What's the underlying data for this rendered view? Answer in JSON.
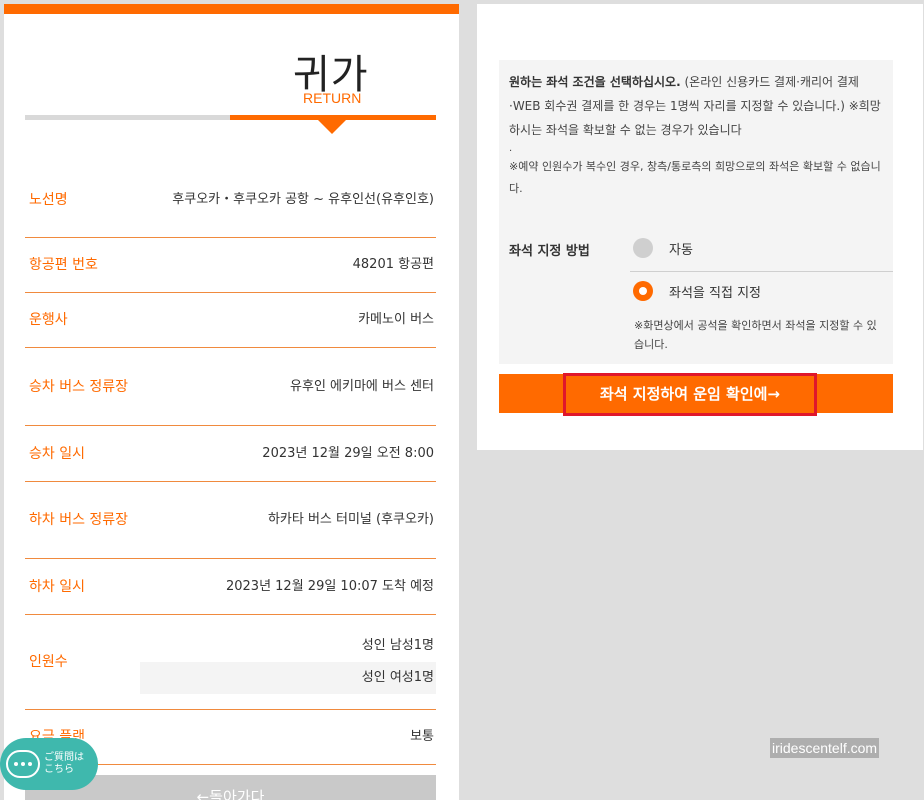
{
  "header": {
    "title_ko": "귀가",
    "title_en": "RETURN"
  },
  "info": {
    "route_label": "노선명",
    "route_value": "후쿠오카・후쿠오카 공항 ~ 유후인선(유후인호)",
    "flight_label": "항공편 번호",
    "flight_value": "48201 항공편",
    "operator_label": "운행사",
    "operator_value": "카메노이 버스",
    "board_stop_label": "승차 버스 정류장",
    "board_stop_value": "유후인 에키마에 버스 센터",
    "board_time_label": "승차 일시",
    "board_time_value": "2023년 12월 29일 오전 8:00",
    "alight_stop_label": "하차 버스 정류장",
    "alight_stop_value": "하카타 버스 터미널 (후쿠오카)",
    "alight_time_label": "하차 일시",
    "alight_time_value": "2023년 12월 29일 10:07 도착 예정",
    "pax_label": "인원수",
    "pax_values": [
      "성인 남성1명",
      "성인 여성1명"
    ],
    "fare_label": "요금 플랜",
    "fare_value": "보통"
  },
  "back_button": "←돌아가다",
  "chat": {
    "line1": "ご質問は",
    "line2": "こちら"
  },
  "seat": {
    "notice_bold": "원하는 좌석 조건을 선택하십시오.",
    "notice_rest": " (온라인 신용카드 결제·캐리어 결제·WEB 회수권 결제를 한 경우는 1명씩 자리를 지정할 수 있습니다.) ※희망하시는 좌석을 확보할 수 없는 경우가 있습니다",
    "notice_dot": ".",
    "notice_small": "※예약 인원수가 복수인 경우, 창측/통로측의 희망으로의 좌석은 확보할 수 없습니다.",
    "method_label": "좌석 지정 방법",
    "option_auto": "자동",
    "option_manual": "좌석을 직접 지정",
    "option_note": "※화면상에서 공석을 확인하면서 좌석을 지정할 수 있습니다.",
    "confirm_button": "좌석 지정하여 운임 확인에→"
  },
  "watermark": "iridescentelf.com",
  "colors": {
    "accent": "#ff6a00",
    "highlight": "#e0172b",
    "chat": "#3fb8ad"
  }
}
